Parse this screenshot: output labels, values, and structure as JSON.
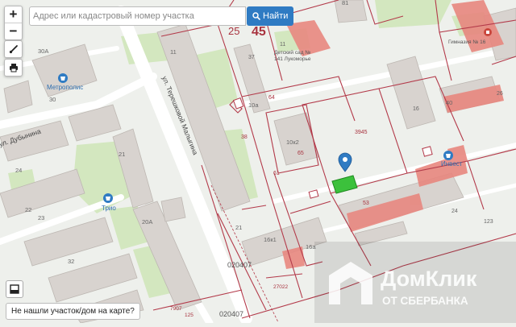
{
  "search": {
    "placeholder": "Адрес или кадастровый номер участка",
    "button_label": "Найти"
  },
  "zoom": {
    "in": "+",
    "out": "−"
  },
  "bottom": {
    "not_found": "Не нашли участок/дом на карте?"
  },
  "watermark": {
    "line1": "ДомКлик",
    "line2": "ОТ СБЕРБАНКА"
  },
  "map": {
    "block_numbers": {
      "n25": "25",
      "n45": "45"
    },
    "street_labels": {
      "tereshkova": "ул. Терешковой Малыгина",
      "dubinina": "ул. Дубынина"
    },
    "pois": {
      "metropolis": "Метрополис",
      "trio": "Трио",
      "gymnasium": "Гимназия № 16",
      "kindergarten_1": "Детский сад №",
      "kindergarten_2": "141 Лукоморье",
      "invest": "Инвест"
    },
    "parcel_labels": {
      "p3945": "3945",
      "p020407a": "020407",
      "p020407b": "020407",
      "p27022": "27022",
      "p7907": "7907",
      "p125": "125",
      "p38": "38",
      "p65": "65",
      "p64": "64",
      "p61": "61",
      "p53": "53",
      "p16": "16",
      "p37": "37",
      "p11": "11",
      "p26": "26",
      "p24": "24",
      "p123": "123"
    },
    "house_numbers": {
      "h30a": "30А",
      "h30": "30",
      "h11": "11",
      "h21": "21",
      "h20a": "20А",
      "h24": "24",
      "h22": "22",
      "h23": "23",
      "h32": "32",
      "h10a": "10а",
      "h10k2": "10к2",
      "h16k1": "16к1",
      "h16a": "16а",
      "h40": "40",
      "h81": "81",
      "h21b": "21"
    }
  },
  "colors": {
    "parcel_border": "#b33a4a",
    "building": "#d8d3cf",
    "highlight_building": "#e8877f",
    "park": "#cfe6b8",
    "selected_parcel": "#3cc13c",
    "marker": "#2f7bc3",
    "search_button": "#2f7bc3"
  }
}
